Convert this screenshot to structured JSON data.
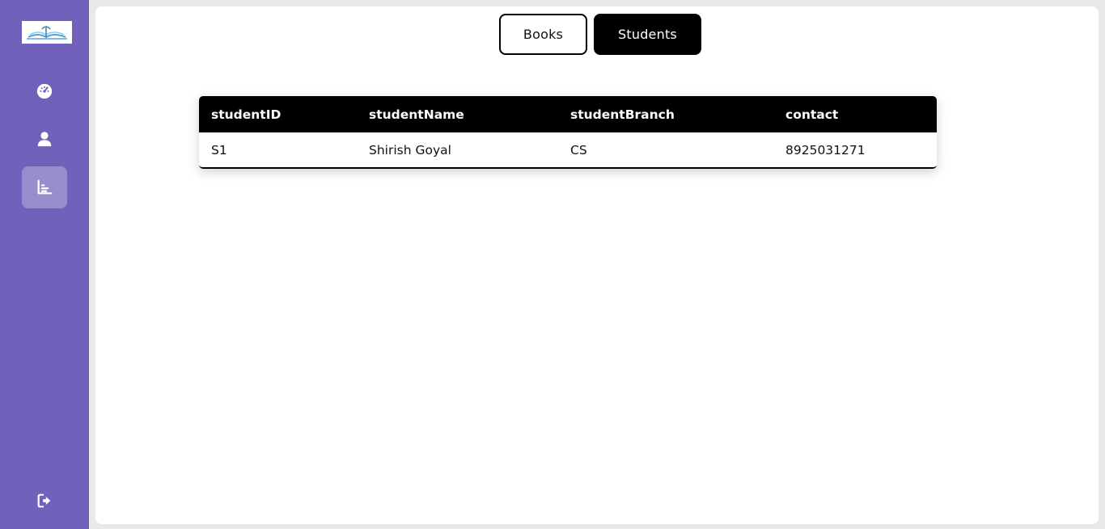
{
  "tabs": {
    "books_label": "Books",
    "students_label": "Students"
  },
  "table": {
    "headers": [
      "studentID",
      "studentName",
      "studentBranch",
      "contact"
    ],
    "rows": [
      [
        "S1",
        "Shirish Goyal",
        "CS",
        "8925031271"
      ]
    ]
  },
  "sidebar": {
    "items": [
      {
        "icon": "dashboard-icon"
      },
      {
        "icon": "user-icon"
      },
      {
        "icon": "chart-icon",
        "active": true
      },
      {
        "icon": "logout-icon"
      }
    ]
  },
  "colors": {
    "sidebar": "#7161ba",
    "accent": "#000000"
  }
}
